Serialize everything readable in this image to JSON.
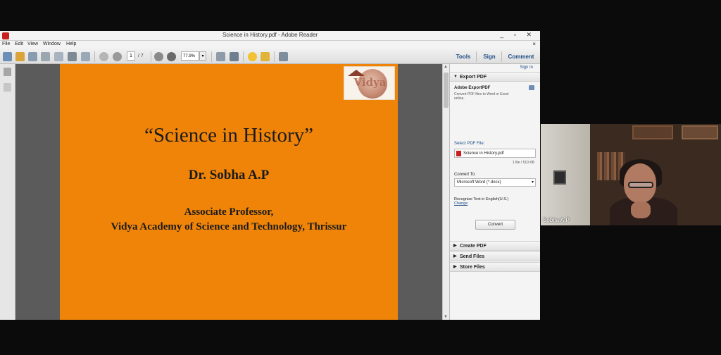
{
  "window": {
    "title": "Science in History.pdf - Adobe Reader",
    "controls": "_ ▫ ✕"
  },
  "menu": {
    "items": [
      "File",
      "Edit",
      "View",
      "Window",
      "Help"
    ],
    "close": "×"
  },
  "toolbar": {
    "page_current": "1",
    "page_total": "/ 7",
    "zoom": "77.9%",
    "tabs": [
      "Tools",
      "Sign",
      "Comment"
    ]
  },
  "slide": {
    "logo_text": "Vidya",
    "title": "“Science in History”",
    "author": "Dr. Sobha A.P",
    "role_line1": "Associate Professor,",
    "role_line2": "Vidya Academy of Science and Technology, Thrissur",
    "background": "#ef8409"
  },
  "panel": {
    "sign_in": "Sign In",
    "export_header": "Export PDF",
    "export_title": "Adobe ExportPDF",
    "export_desc_1": "Convert PDF files to Word or Excel",
    "export_desc_2": "online.",
    "select_label": "Select PDF File:",
    "file_name": "Science in History.pdf",
    "file_info": "1 file / 510 KB",
    "convert_to_label": "Convert To:",
    "convert_to_value": "Microsoft Word (*.docx)",
    "recognize_text": "Recognize Text in English(U.S.)",
    "change_link": "Change",
    "convert_button": "Convert",
    "sections": [
      "Create PDF",
      "Send Files",
      "Store Files"
    ]
  },
  "video": {
    "participant_name": "Sobha A.P"
  }
}
